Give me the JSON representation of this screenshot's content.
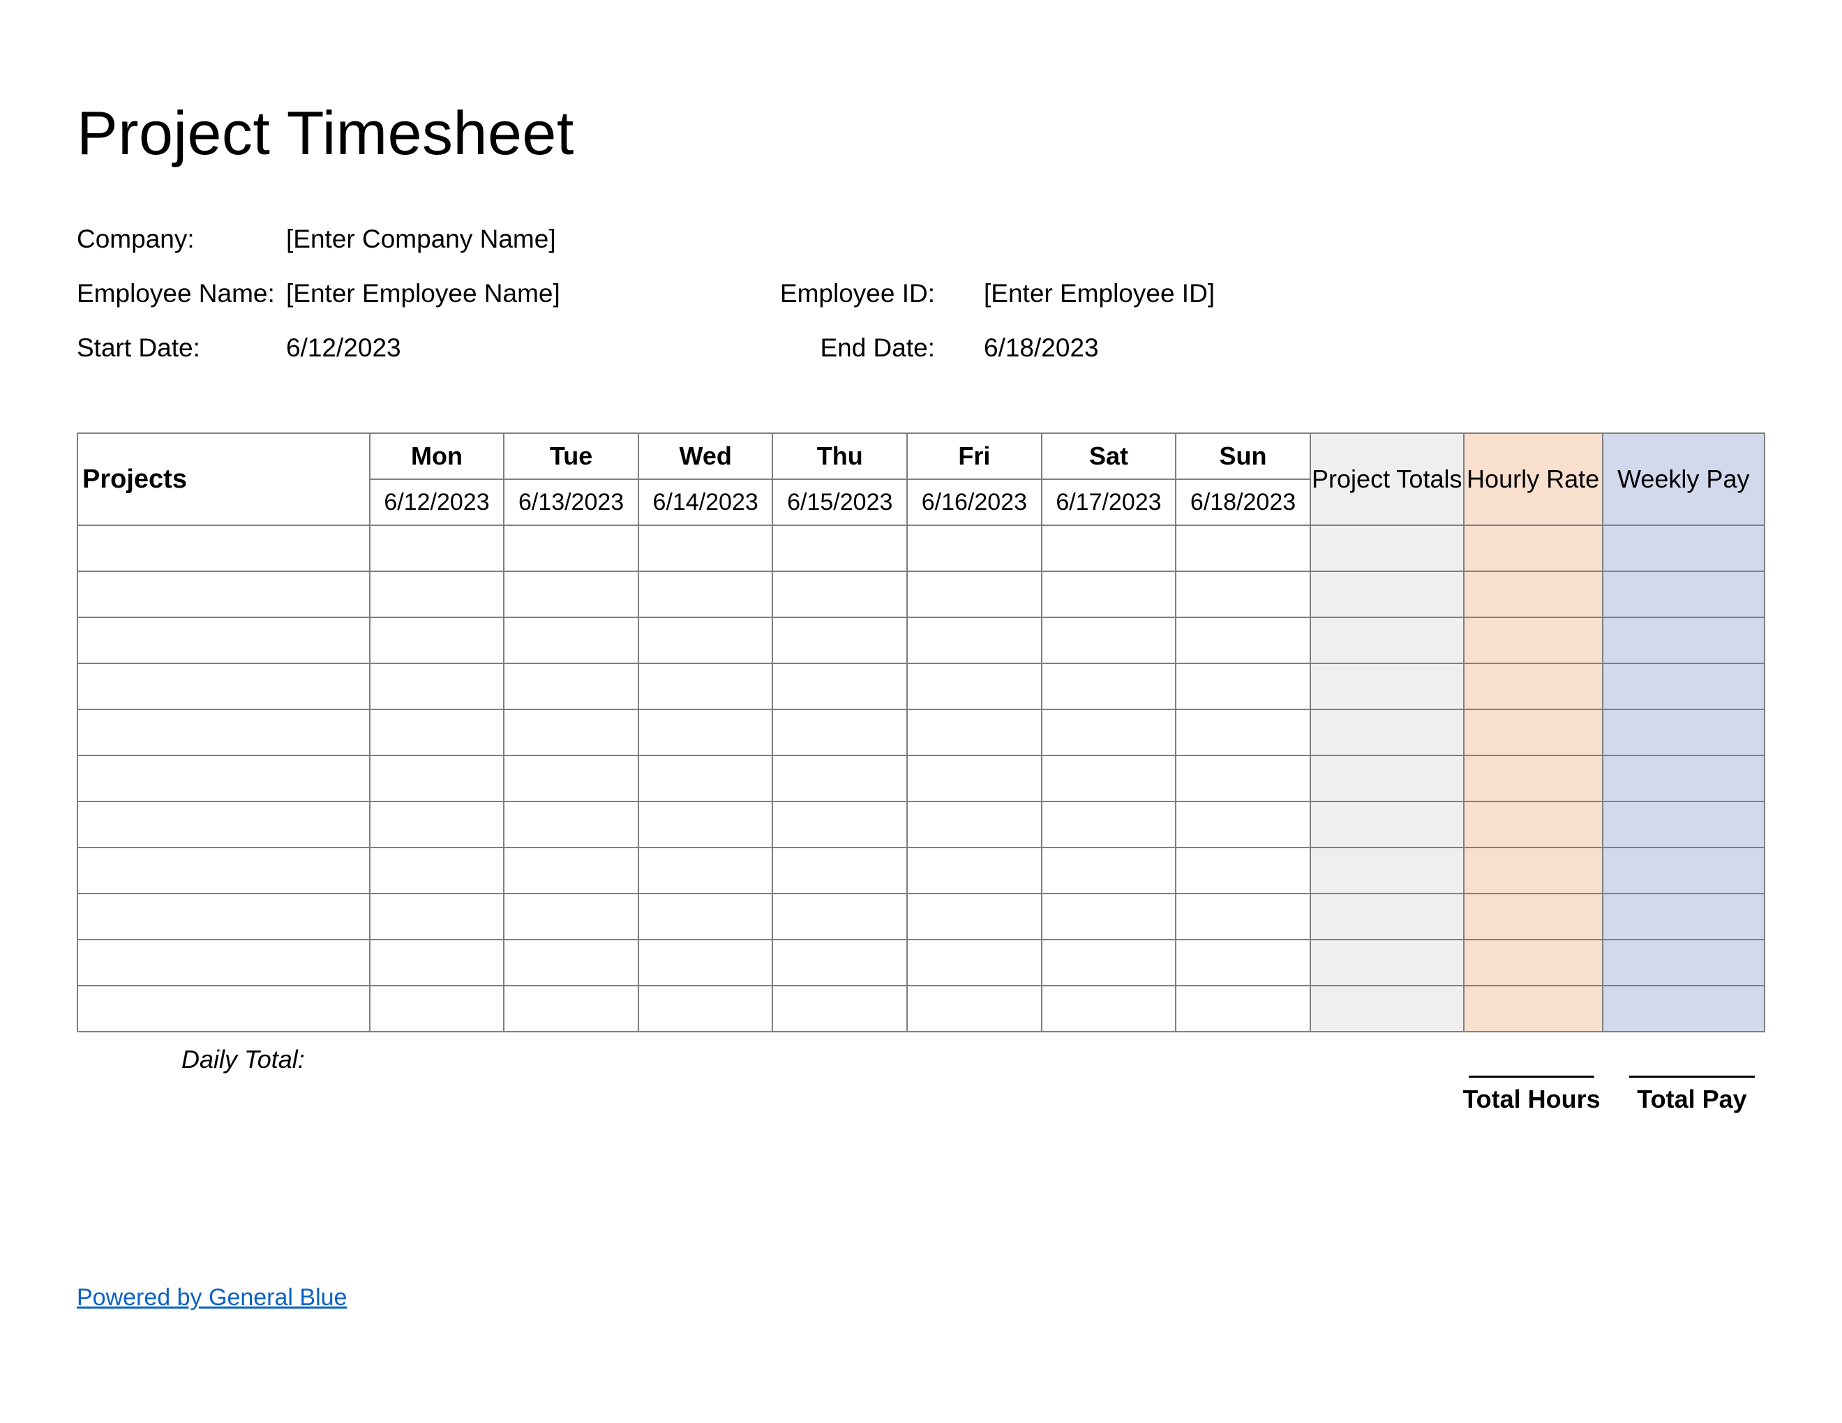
{
  "title": "Project Timesheet",
  "info": {
    "company_label": "Company:",
    "company_value": "[Enter Company Name]",
    "employee_name_label": "Employee Name:",
    "employee_name_value": "[Enter Employee Name]",
    "employee_id_label": "Employee ID:",
    "employee_id_value": "[Enter Employee ID]",
    "start_date_label": "Start Date:",
    "start_date_value": "6/12/2023",
    "end_date_label": "End Date:",
    "end_date_value": "6/18/2023"
  },
  "table": {
    "projects_header": "Projects",
    "days": [
      "Mon",
      "Tue",
      "Wed",
      "Thu",
      "Fri",
      "Sat",
      "Sun"
    ],
    "dates": [
      "6/12/2023",
      "6/13/2023",
      "6/14/2023",
      "6/15/2023",
      "6/16/2023",
      "6/17/2023",
      "6/18/2023"
    ],
    "project_totals_header": "Project Totals",
    "hourly_rate_header": "Hourly Rate",
    "weekly_pay_header": "Weekly Pay",
    "row_count": 11
  },
  "footer": {
    "daily_total_label": "Daily Total:",
    "total_hours_label": "Total Hours",
    "total_pay_label": "Total Pay",
    "powered_by": "Powered by General Blue"
  }
}
